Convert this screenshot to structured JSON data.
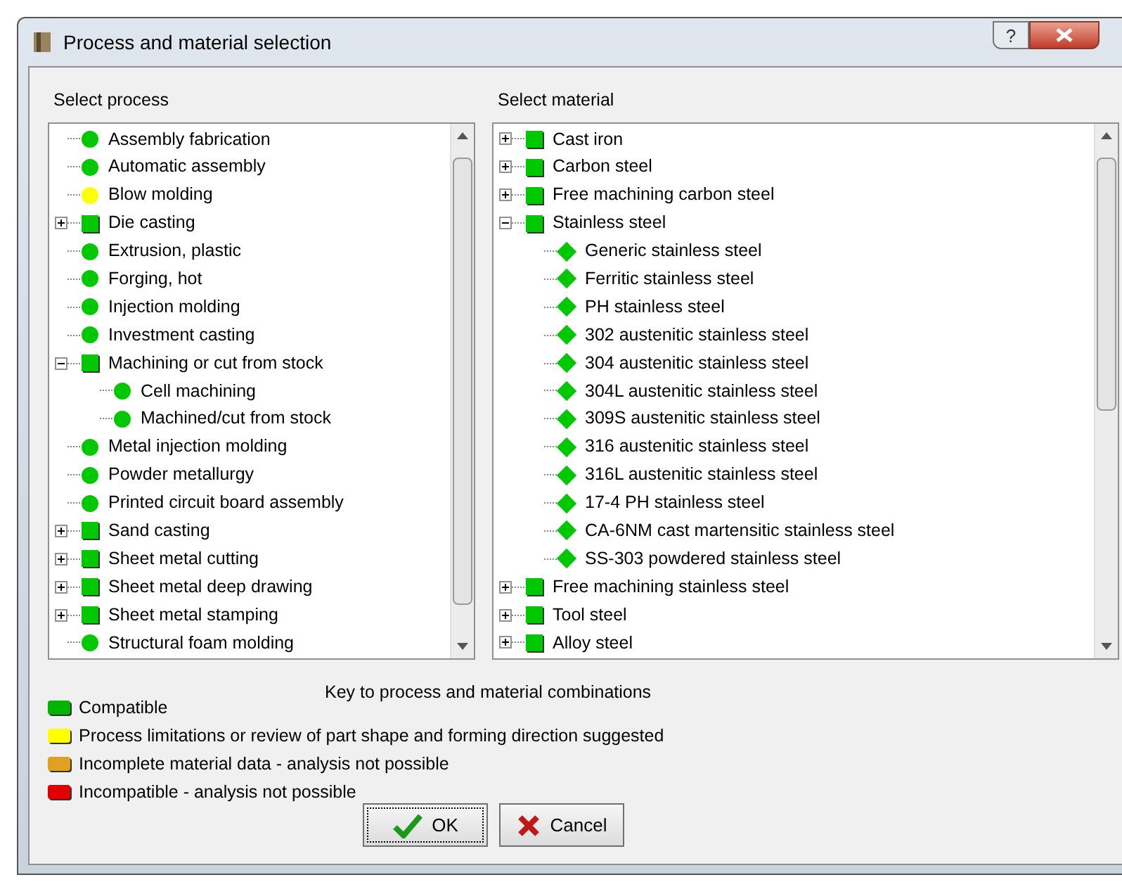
{
  "window": {
    "title": "Process and material selection"
  },
  "process_panel": {
    "label": "Select process",
    "items": [
      {
        "label": "Assembly fabrication",
        "kind": "circle",
        "color": "#00c800"
      },
      {
        "label": "Automatic assembly",
        "kind": "circle",
        "color": "#00c800"
      },
      {
        "label": "Blow molding",
        "kind": "circle",
        "color": "#ffff00"
      },
      {
        "label": "Die casting",
        "kind": "square",
        "color": "#00c800",
        "expanded": false
      },
      {
        "label": "Extrusion, plastic",
        "kind": "circle",
        "color": "#00c800"
      },
      {
        "label": "Forging, hot",
        "kind": "circle",
        "color": "#00c800"
      },
      {
        "label": "Injection molding",
        "kind": "circle",
        "color": "#00c800"
      },
      {
        "label": "Investment casting",
        "kind": "circle",
        "color": "#00c800"
      },
      {
        "label": "Machining or cut from stock",
        "kind": "square",
        "color": "#00c800",
        "expanded": true,
        "children": [
          {
            "label": "Cell machining",
            "kind": "circle",
            "color": "#00c800"
          },
          {
            "label": "Machined/cut from stock",
            "kind": "circle",
            "color": "#00c800"
          }
        ]
      },
      {
        "label": "Metal injection molding",
        "kind": "circle",
        "color": "#00c800"
      },
      {
        "label": "Powder metallurgy",
        "kind": "circle",
        "color": "#00c800"
      },
      {
        "label": "Printed circuit board assembly",
        "kind": "circle",
        "color": "#00c800"
      },
      {
        "label": "Sand casting",
        "kind": "square",
        "color": "#00c800",
        "expanded": false
      },
      {
        "label": "Sheet metal cutting",
        "kind": "square",
        "color": "#00c800",
        "expanded": false
      },
      {
        "label": "Sheet metal deep drawing",
        "kind": "square",
        "color": "#00c800",
        "expanded": false
      },
      {
        "label": "Sheet metal stamping",
        "kind": "square",
        "color": "#00c800",
        "expanded": false
      },
      {
        "label": "Structural foam molding",
        "kind": "circle",
        "color": "#00c800"
      }
    ]
  },
  "material_panel": {
    "label": "Select material",
    "items": [
      {
        "label": "Cast iron",
        "kind": "square",
        "color": "#00c800",
        "expanded": false
      },
      {
        "label": "Carbon steel",
        "kind": "square",
        "color": "#00c800",
        "expanded": false
      },
      {
        "label": "Free machining carbon steel",
        "kind": "square",
        "color": "#00c800",
        "expanded": false
      },
      {
        "label": "Stainless steel",
        "kind": "square",
        "color": "#00c800",
        "expanded": true,
        "children": [
          {
            "label": "Generic stainless steel",
            "kind": "diamond",
            "color": "#00c800"
          },
          {
            "label": "Ferritic stainless steel",
            "kind": "diamond",
            "color": "#00c800"
          },
          {
            "label": "PH stainless steel",
            "kind": "diamond",
            "color": "#00c800"
          },
          {
            "label": "302 austenitic stainless steel",
            "kind": "diamond",
            "color": "#00c800"
          },
          {
            "label": "304 austenitic stainless steel",
            "kind": "diamond",
            "color": "#00c800"
          },
          {
            "label": "304L austenitic stainless steel",
            "kind": "diamond",
            "color": "#00c800"
          },
          {
            "label": "309S austenitic stainless steel",
            "kind": "diamond",
            "color": "#00c800"
          },
          {
            "label": "316 austenitic stainless steel",
            "kind": "diamond",
            "color": "#00c800"
          },
          {
            "label": "316L austenitic stainless steel",
            "kind": "diamond",
            "color": "#00c800"
          },
          {
            "label": "17-4 PH stainless steel",
            "kind": "diamond",
            "color": "#00c800"
          },
          {
            "label": "CA-6NM cast martensitic stainless steel",
            "kind": "diamond",
            "color": "#00c800"
          },
          {
            "label": "SS-303 powdered stainless steel",
            "kind": "diamond",
            "color": "#00c800"
          }
        ]
      },
      {
        "label": "Free machining stainless steel",
        "kind": "square",
        "color": "#00c800",
        "expanded": false
      },
      {
        "label": "Tool steel",
        "kind": "square",
        "color": "#00c800",
        "expanded": false
      },
      {
        "label": "Alloy steel",
        "kind": "square",
        "color": "#00c800",
        "expanded": false
      }
    ]
  },
  "legend": {
    "title": "Key to process and material combinations",
    "items": [
      {
        "label": "Compatible",
        "color": "#00b400"
      },
      {
        "label": "Process limitations or review of part shape and forming direction suggested",
        "color": "#ffff00"
      },
      {
        "label": "Incomplete material data - analysis not possible",
        "color": "#e0a020"
      },
      {
        "label": "Incompatible - analysis not possible",
        "color": "#e00000"
      }
    ]
  },
  "buttons": [
    {
      "label": "OK",
      "kind": "ok"
    },
    {
      "label": "Cancel",
      "kind": "cancel"
    }
  ],
  "title_buttons": [
    {
      "label": "?",
      "kind": "help"
    }
  ]
}
